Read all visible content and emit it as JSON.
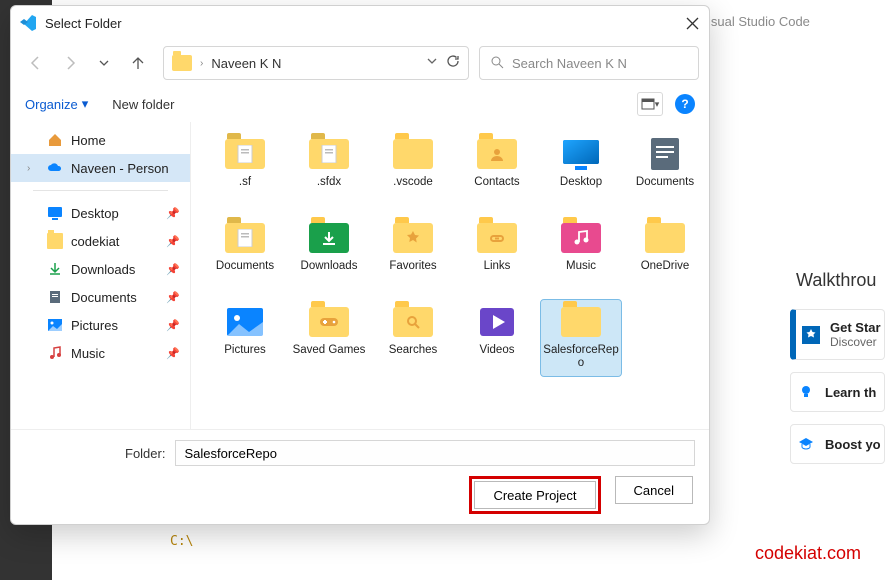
{
  "background": {
    "vscode_title": "isual Studio Code",
    "walkthroughs_title": "Walkthrou",
    "cards": [
      {
        "heading": "Get Star",
        "sub": "Discover"
      },
      {
        "heading": "Learn th",
        "sub": ""
      },
      {
        "heading": "Boost yo",
        "sub": ""
      }
    ],
    "terminal_path": "C:\\",
    "watermark": "codekiat.com"
  },
  "dialog": {
    "title": "Select Folder",
    "address_path": "Naveen K N",
    "search_placeholder": "Search Naveen K N",
    "organize_label": "Organize",
    "newfolder_label": "New folder",
    "sidebar": {
      "home": "Home",
      "onedrive": "Naveen - Person",
      "quick": [
        {
          "label": "Desktop",
          "icon": "desktop"
        },
        {
          "label": "codekiat",
          "icon": "folder-y"
        },
        {
          "label": "Downloads",
          "icon": "dl"
        },
        {
          "label": "Documents",
          "icon": "doc"
        },
        {
          "label": "Pictures",
          "icon": "pic"
        },
        {
          "label": "Music",
          "icon": "music"
        }
      ]
    },
    "grid": [
      {
        "label": ".sf",
        "icon": "folder-doc"
      },
      {
        "label": ".sfdx",
        "icon": "folder-doc"
      },
      {
        "label": ".vscode",
        "icon": "folder"
      },
      {
        "label": "Contacts",
        "icon": "contacts"
      },
      {
        "label": "Desktop",
        "icon": "desktop-big"
      },
      {
        "label": "Documents",
        "icon": "docs-big"
      },
      {
        "label": "Documents",
        "icon": "folder-doc"
      },
      {
        "label": "Downloads",
        "icon": "downloads"
      },
      {
        "label": "Favorites",
        "icon": "favorites"
      },
      {
        "label": "Links",
        "icon": "links"
      },
      {
        "label": "Music",
        "icon": "music-big"
      },
      {
        "label": "OneDrive",
        "icon": "folder"
      },
      {
        "label": "Pictures",
        "icon": "pictures-big"
      },
      {
        "label": "Saved Games",
        "icon": "games"
      },
      {
        "label": "Searches",
        "icon": "searches"
      },
      {
        "label": "Videos",
        "icon": "videos"
      },
      {
        "label": "SalesforceRepo",
        "icon": "folder",
        "selected": true
      }
    ],
    "folder_label": "Folder:",
    "folder_value": "SalesforceRepo",
    "create_label": "Create Project",
    "cancel_label": "Cancel"
  }
}
